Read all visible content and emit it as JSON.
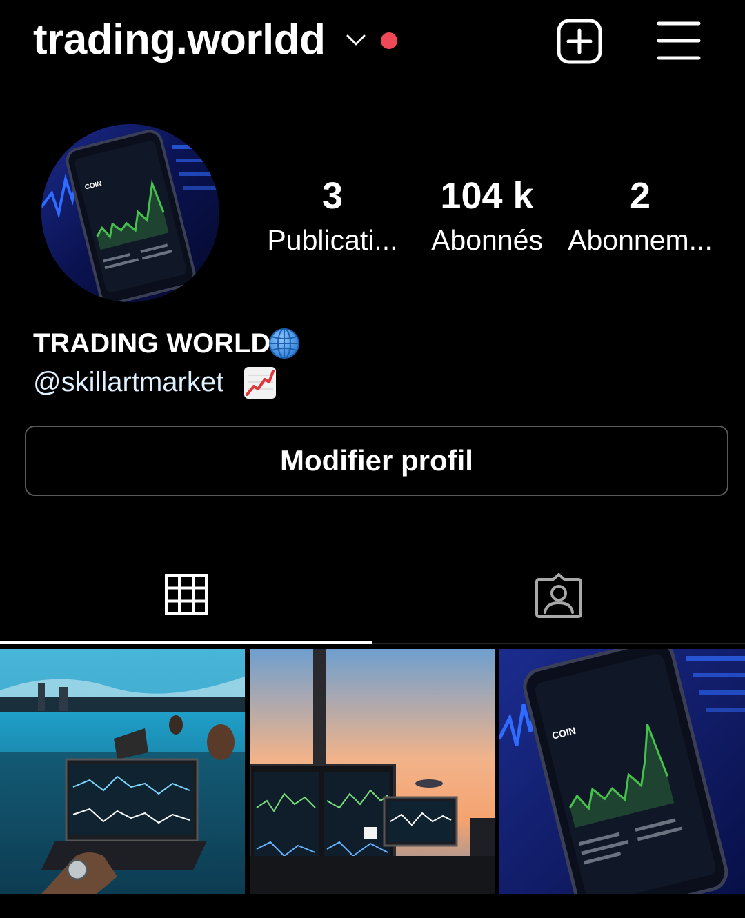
{
  "header": {
    "username": "trading.worldd",
    "icons": {
      "account_switch": "chevron-down-icon",
      "notification": "red-dot-icon",
      "create": "plus-square-icon",
      "menu": "hamburger-menu-icon"
    }
  },
  "profile": {
    "stats": [
      {
        "value": "3",
        "label": "Publicati..."
      },
      {
        "value": "104 k",
        "label": "Abonnés"
      },
      {
        "value": "2",
        "label": "Abonnem..."
      }
    ],
    "display_name": "TRADING WORLD",
    "display_name_emoji": "globe-icon",
    "bio_mention": "@skillartmarket",
    "bio_emoji": "chart-increasing-icon",
    "edit_button_label": "Modifier profil"
  },
  "tabs": {
    "items": [
      {
        "icon": "grid-icon",
        "active": true
      },
      {
        "icon": "tagged-person-icon",
        "active": false
      }
    ]
  },
  "posts": {
    "count": 3
  },
  "colors": {
    "background": "#000000",
    "text": "#ffffff",
    "notification_dot": "#ed4956",
    "button_border": "#5a5a5a",
    "tab_inactive": "#a8a8a8"
  }
}
